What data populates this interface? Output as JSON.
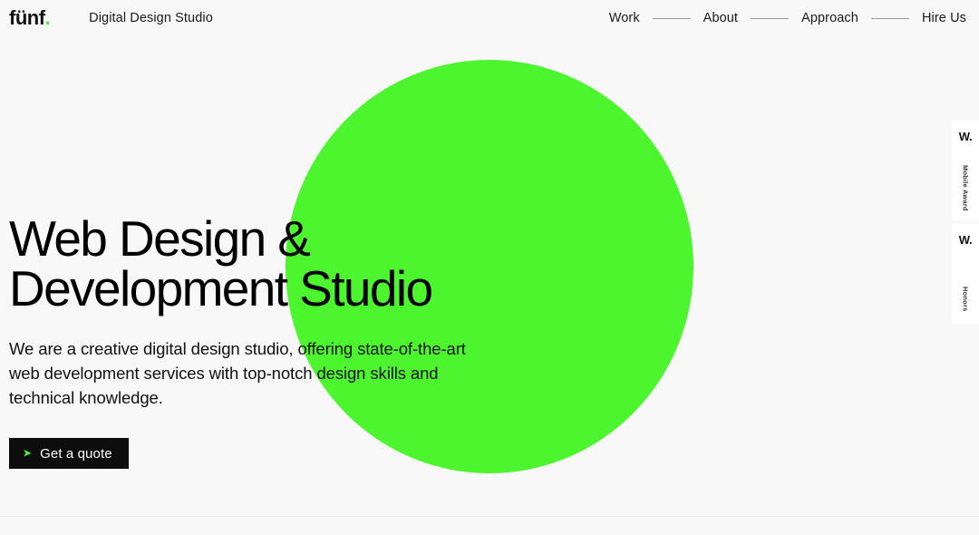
{
  "theme": {
    "background": "#f8f8f8",
    "accent_green": "#4df52e",
    "text_dark": "#111111",
    "button_bg": "#0d0d0d"
  },
  "header": {
    "logo": {
      "text": "fünf",
      "dot": "."
    },
    "tagline": "Digital Design Studio",
    "nav": [
      {
        "label": "Work"
      },
      {
        "label": "About"
      },
      {
        "label": "Approach"
      },
      {
        "label": "Hire Us"
      }
    ]
  },
  "hero": {
    "heading_line1": "Web Design &",
    "heading_line2": "Development Studio",
    "paragraph": "We are a creative digital design studio, offering state-of-the-art web development services with top-notch design skills and technical knowledge.",
    "cta": {
      "label": "Get a quote",
      "icon": "arrow-right-icon",
      "glyph": "➤"
    }
  },
  "awards": [
    {
      "mark": "W.",
      "label": "Mobile Award"
    },
    {
      "mark": "W.",
      "label": "Honors"
    }
  ]
}
